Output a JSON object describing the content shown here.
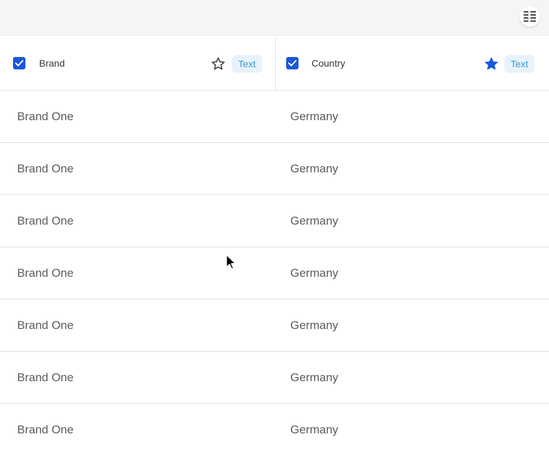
{
  "toolbar": {
    "menu_icon": "column-list-icon"
  },
  "columns": [
    {
      "label": "Brand",
      "checked": true,
      "starred": false,
      "type_label": "Text"
    },
    {
      "label": "Country",
      "checked": true,
      "starred": true,
      "type_label": "Text"
    }
  ],
  "rows": [
    {
      "brand": "Brand One",
      "country": "Germany"
    },
    {
      "brand": "Brand One",
      "country": "Germany"
    },
    {
      "brand": "Brand One",
      "country": "Germany"
    },
    {
      "brand": "Brand One",
      "country": "Germany"
    },
    {
      "brand": "Brand One",
      "country": "Germany"
    },
    {
      "brand": "Brand One",
      "country": "Germany"
    },
    {
      "brand": "Brand One",
      "country": "Germany"
    }
  ],
  "colors": {
    "accent": "#1a56db",
    "pill_bg": "#e8f2fc",
    "pill_text": "#3a9ad9",
    "cell_text": "#5b5b5b"
  }
}
